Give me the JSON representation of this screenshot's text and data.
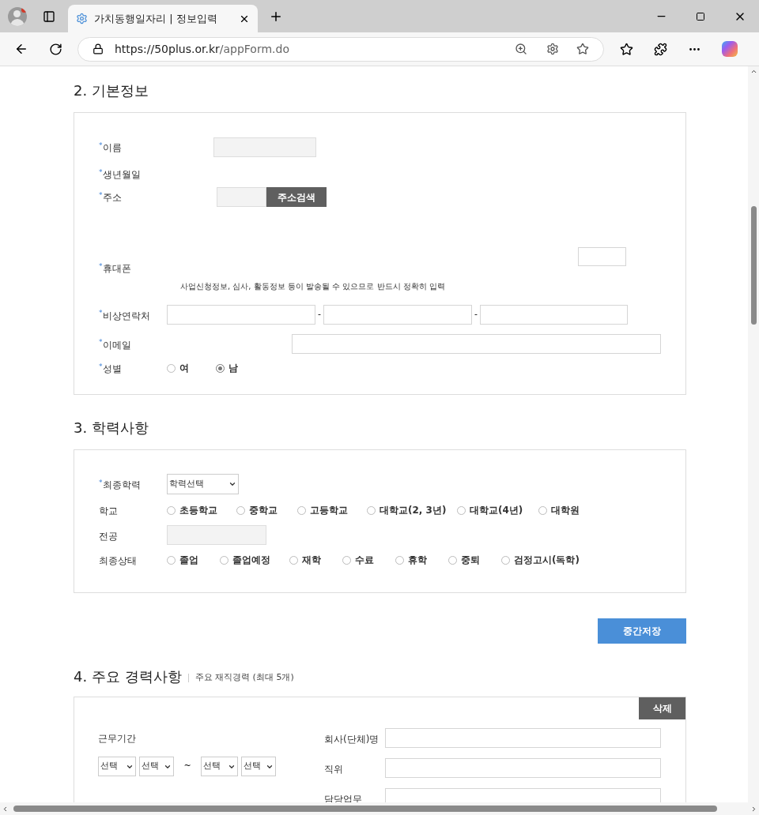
{
  "browser": {
    "tab_title": "가치동행일자리 | 정보입력",
    "url_host": "https://50plus.or.kr",
    "url_path": "/appForm.do"
  },
  "basic": {
    "heading": "2. 기본정보",
    "name_label": "이름",
    "name_required": "*",
    "birth_label": "생년월일",
    "birth_required": "*",
    "address_label": "주소",
    "address_required": "*",
    "address_button": "주소검색",
    "phone_label": "휴대폰",
    "phone_required": "*",
    "emergency_required": "*",
    "email_required": "*",
    "gender_required": "*",
    "phone_hint": "사업신청정보, 심사, 활동정보 등이 발송될 수 있으므로 반드시 정확히 입력",
    "emergency_label": "비상연락처",
    "separators": [
      "-",
      "-"
    ],
    "email_label": "이메일",
    "gender_label": "성별",
    "gender_options": [
      {
        "label": "여",
        "selected": false
      },
      {
        "label": "남",
        "selected": true
      }
    ]
  },
  "education": {
    "heading": "3. 학력사항",
    "final_label": "최종학력",
    "final_required": "*",
    "final_select": "학력선택",
    "school_label": "학교",
    "school_options": [
      {
        "label": "초등학교",
        "selected": false
      },
      {
        "label": "중학교",
        "selected": false
      },
      {
        "label": "고등학교",
        "selected": false
      },
      {
        "label": "대학교(2, 3년)",
        "selected": false
      },
      {
        "label": "대학교(4년)",
        "selected": false
      },
      {
        "label": "대학원",
        "selected": false
      }
    ],
    "major_label": "전공",
    "status_label": "최종상태",
    "status_options": [
      {
        "label": "졸업",
        "selected": false
      },
      {
        "label": "졸업예정",
        "selected": false
      },
      {
        "label": "재학",
        "selected": false
      },
      {
        "label": "수료",
        "selected": false
      },
      {
        "label": "휴학",
        "selected": false
      },
      {
        "label": "중퇴",
        "selected": false
      },
      {
        "label": "검정고시(독학)",
        "selected": false
      }
    ]
  },
  "save_button": "중간저장",
  "career": {
    "heading": "4. 주요 경력사항",
    "subheading": "주요 재직경력 (최대 5개)",
    "delete_button": "삭제",
    "period_label": "근무기간",
    "period_selects": [
      "선택",
      "선택",
      "선택",
      "선택"
    ],
    "tilde": "~",
    "company_label": "회사(단체)명",
    "position_label": "직위",
    "duty_label": "담당업무"
  }
}
